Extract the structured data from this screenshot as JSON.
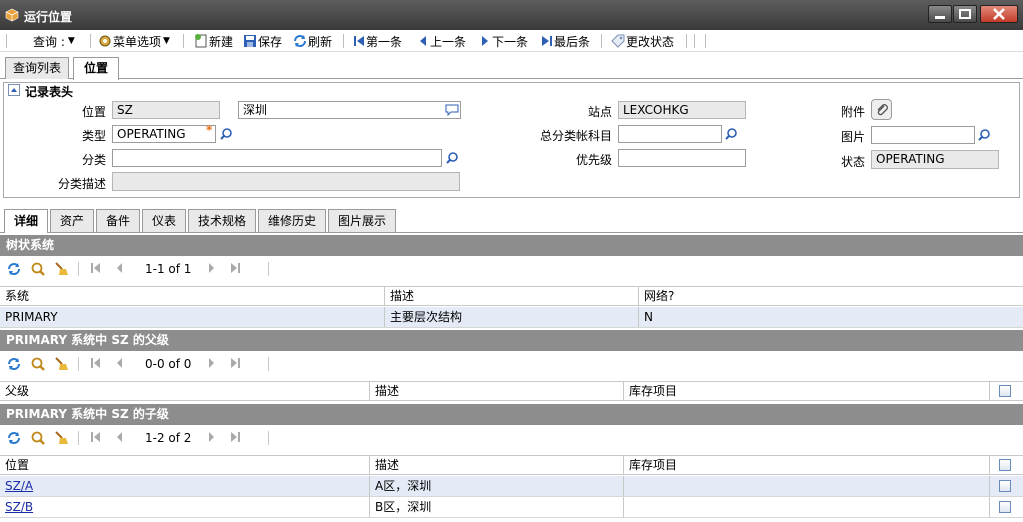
{
  "window": {
    "title": "运行位置"
  },
  "toolbar": {
    "query": "查询 :",
    "menu": "菜单选项",
    "new": "新建",
    "save": "保存",
    "refresh": "刷新",
    "first": "第一条",
    "prev": "上一条",
    "next": "下一条",
    "last": "最后条",
    "change_status": "更改状态"
  },
  "tabs": {
    "list": "查询列表",
    "location": "位置"
  },
  "header": {
    "section": "记录表头",
    "location_label": "位置",
    "location_value": "SZ",
    "location_desc": "深圳",
    "type_label": "类型",
    "type_value": "OPERATING",
    "class_label": "分类",
    "class_value": "",
    "class_desc_label": "分类描述",
    "class_desc_value": "",
    "site_label": "站点",
    "site_value": "LEXCOHKG",
    "gl_label": "总分类帐科目",
    "gl_value": "",
    "priority_label": "优先级",
    "priority_value": "",
    "attach_label": "附件",
    "image_label": "图片",
    "image_value": "",
    "status_label": "状态",
    "status_value": "OPERATING"
  },
  "detail_tabs": [
    "详细",
    "资产",
    "备件",
    "仪表",
    "技术规格",
    "维修历史",
    "图片展示"
  ],
  "systems": {
    "title": "树状系统",
    "pager": "1-1 of 1",
    "columns": [
      "系统",
      "描述",
      "网络?"
    ],
    "rows": [
      [
        "PRIMARY",
        "主要层次结构",
        "N"
      ]
    ]
  },
  "parents": {
    "title": "PRIMARY 系统中 SZ 的父级",
    "pager": "0-0 of 0",
    "columns": [
      "父级",
      "描述",
      "库存项目"
    ]
  },
  "children": {
    "title": "PRIMARY 系统中 SZ 的子级",
    "pager": "1-2 of 2",
    "columns": [
      "位置",
      "描述",
      "库存项目"
    ],
    "rows": [
      [
        "SZ/A",
        "A区，深圳",
        ""
      ],
      [
        "SZ/B",
        "B区，深圳",
        ""
      ]
    ]
  }
}
